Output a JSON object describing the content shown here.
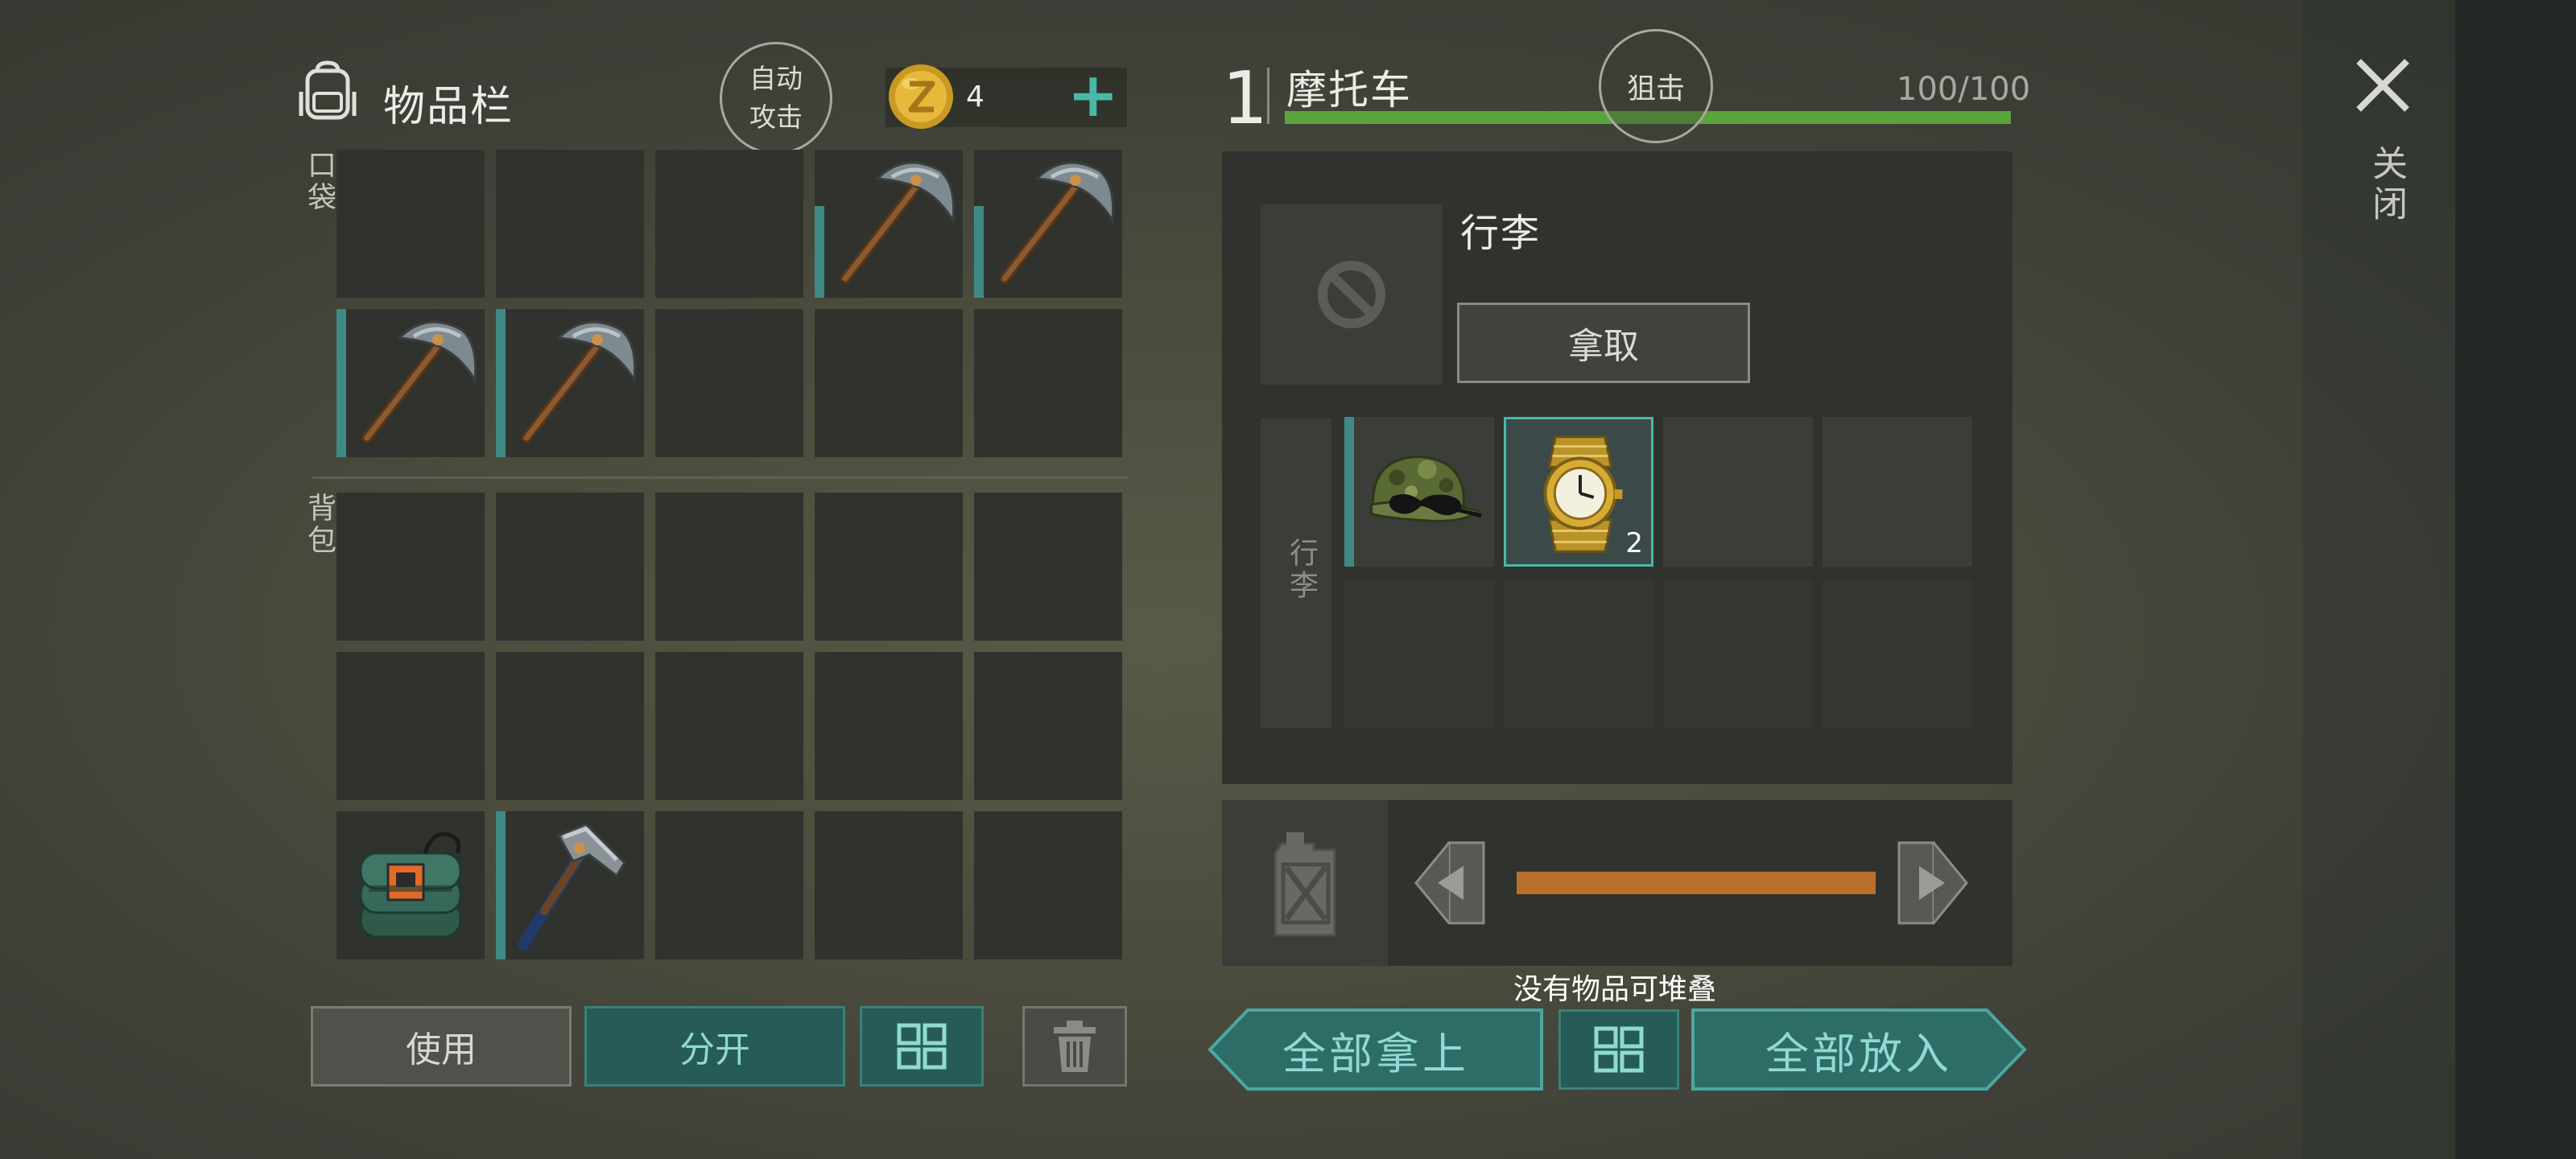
{
  "inventory": {
    "title": "物品栏",
    "auto_attack": [
      "自动",
      "攻击"
    ],
    "coins": "4",
    "pocket_label": "口袋",
    "backpack_label": "背包",
    "pocket_slots": [
      "empty",
      "empty",
      "empty",
      "pickaxe",
      "pickaxe",
      "pickaxe",
      "pickaxe",
      "empty",
      "empty",
      "empty"
    ],
    "backpack_slots": [
      "empty",
      "empty",
      "empty",
      "empty",
      "empty",
      "empty",
      "empty",
      "empty",
      "empty",
      "empty",
      "explosive-pack",
      "hammer",
      "empty",
      "empty",
      "empty"
    ],
    "buttons": {
      "use": "使用",
      "split": "分开"
    }
  },
  "vehicle": {
    "number": "1",
    "name": "摩托车",
    "snipe": "狙击",
    "health_text": "100/100",
    "health_fraction": 1.0,
    "luggage_title": "行李",
    "take_button": "拿取",
    "luggage_label": "行李",
    "luggage_items": [
      {
        "icon": "military-cap-with-sunglasses",
        "qty": ""
      },
      {
        "icon": "gold-wristwatch",
        "qty": "2"
      }
    ],
    "fuel_fraction": 1.0,
    "no_stack_message": "没有物品可堆叠",
    "take_all": "全部拿上",
    "put_all": "全部放入"
  },
  "close_label": "关闭",
  "colors": {
    "accent_teal": "#4ab8a8",
    "health_green": "#5aa43c",
    "fuel_orange": "#b8702a"
  }
}
